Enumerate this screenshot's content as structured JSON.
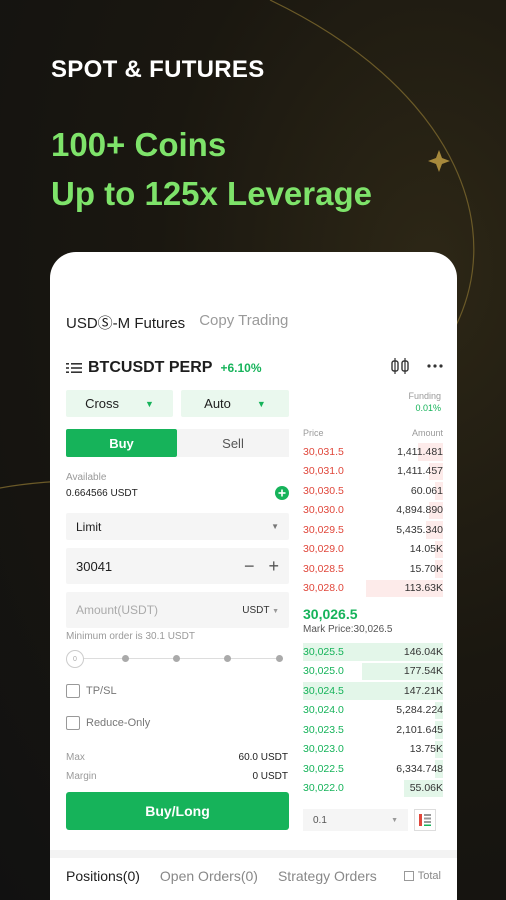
{
  "headline": {
    "small": "SPOT & FUTURES",
    "line1": "100+ Coins",
    "line2": "Up to 125x Leverage"
  },
  "tabs": {
    "active": "USDⓈ-M Futures",
    "inactive": "Copy Trading"
  },
  "symbol": {
    "name": "BTCUSDT PERP",
    "change": "+6.10%"
  },
  "controls": {
    "margin_mode": "Cross",
    "leverage_mode": "Auto",
    "funding_label": "Funding",
    "funding_value": "0.01%"
  },
  "side": {
    "buy": "Buy",
    "sell": "Sell"
  },
  "account": {
    "available_label": "Available",
    "available_value": "0.664566 USDT"
  },
  "order": {
    "type": "Limit",
    "price": "30041",
    "amount_placeholder": "Amount(USDT)",
    "amount_unit": "USDT",
    "min_note": "Minimum order is 30.1 USDT",
    "slider_start": "0"
  },
  "options": {
    "tpsl": "TP/SL",
    "reduce_only": "Reduce-Only"
  },
  "summary": {
    "max_label": "Max",
    "max_value": "60.0 USDT",
    "margin_label": "Margin",
    "margin_value": "0 USDT"
  },
  "action": {
    "buy_long": "Buy/Long"
  },
  "orderbook": {
    "price_header": "Price",
    "amount_header": "Amount",
    "asks": [
      {
        "price": "30,031.5",
        "amount": "1,411.481",
        "depth": 0.18
      },
      {
        "price": "30,031.0",
        "amount": "1,411.457",
        "depth": 0.1
      },
      {
        "price": "30,030.5",
        "amount": "60.061",
        "depth": 0.06
      },
      {
        "price": "30,030.0",
        "amount": "4,894.890",
        "depth": 0.1
      },
      {
        "price": "30,029.5",
        "amount": "5,435.340",
        "depth": 0.12
      },
      {
        "price": "30,029.0",
        "amount": "14.05K",
        "depth": 0.06
      },
      {
        "price": "30,028.5",
        "amount": "15.70K",
        "depth": 0.06
      },
      {
        "price": "30,028.0",
        "amount": "113.63K",
        "depth": 0.55
      }
    ],
    "mid_price": "30,026.5",
    "mark_price": "Mark Price:30,026.5",
    "bids": [
      {
        "price": "30,025.5",
        "amount": "146.04K",
        "depth": 1.0
      },
      {
        "price": "30,025.0",
        "amount": "177.54K",
        "depth": 0.58
      },
      {
        "price": "30,024.5",
        "amount": "147.21K",
        "depth": 1.0
      },
      {
        "price": "30,024.0",
        "amount": "5,284.224",
        "depth": 0.06
      },
      {
        "price": "30,023.5",
        "amount": "2,101.645",
        "depth": 0.06
      },
      {
        "price": "30,023.0",
        "amount": "13.75K",
        "depth": 0.06
      },
      {
        "price": "30,022.5",
        "amount": "6,334.748",
        "depth": 0.06
      },
      {
        "price": "30,022.0",
        "amount": "55.06K",
        "depth": 0.28
      }
    ],
    "precision": "0.1"
  },
  "bottom_tabs": {
    "positions": "Positions(0)",
    "open_orders": "Open Orders(0)",
    "strategy": "Strategy Orders",
    "total": "Total"
  },
  "colors": {
    "green": "#16b35a",
    "red": "#e0473b",
    "headline_green": "#7ee36a",
    "ask_bar": "#fdebea",
    "bid_bar": "#e3f6e9"
  },
  "icons": [
    "menu-icon",
    "chart-icon",
    "more-icon",
    "plus-circle-icon",
    "minus-icon",
    "plus-icon",
    "grid-icon",
    "checkbox-icon"
  ]
}
